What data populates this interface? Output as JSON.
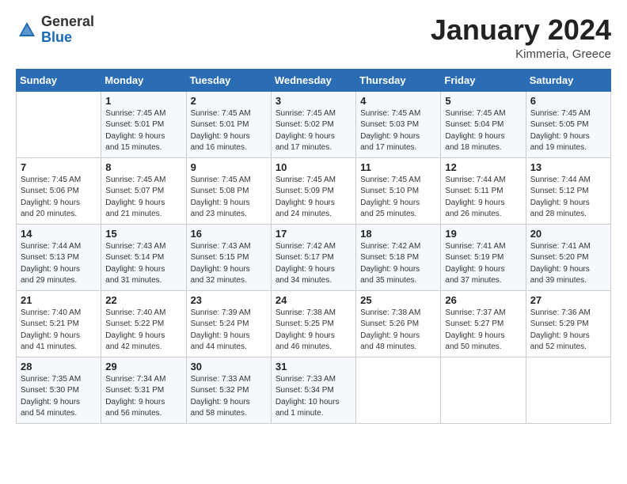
{
  "header": {
    "logo_general": "General",
    "logo_blue": "Blue",
    "month_title": "January 2024",
    "location": "Kimmeria, Greece"
  },
  "weekdays": [
    "Sunday",
    "Monday",
    "Tuesday",
    "Wednesday",
    "Thursday",
    "Friday",
    "Saturday"
  ],
  "weeks": [
    [
      {
        "day": "",
        "info": ""
      },
      {
        "day": "1",
        "info": "Sunrise: 7:45 AM\nSunset: 5:01 PM\nDaylight: 9 hours\nand 15 minutes."
      },
      {
        "day": "2",
        "info": "Sunrise: 7:45 AM\nSunset: 5:01 PM\nDaylight: 9 hours\nand 16 minutes."
      },
      {
        "day": "3",
        "info": "Sunrise: 7:45 AM\nSunset: 5:02 PM\nDaylight: 9 hours\nand 17 minutes."
      },
      {
        "day": "4",
        "info": "Sunrise: 7:45 AM\nSunset: 5:03 PM\nDaylight: 9 hours\nand 17 minutes."
      },
      {
        "day": "5",
        "info": "Sunrise: 7:45 AM\nSunset: 5:04 PM\nDaylight: 9 hours\nand 18 minutes."
      },
      {
        "day": "6",
        "info": "Sunrise: 7:45 AM\nSunset: 5:05 PM\nDaylight: 9 hours\nand 19 minutes."
      }
    ],
    [
      {
        "day": "7",
        "info": "Sunrise: 7:45 AM\nSunset: 5:06 PM\nDaylight: 9 hours\nand 20 minutes."
      },
      {
        "day": "8",
        "info": "Sunrise: 7:45 AM\nSunset: 5:07 PM\nDaylight: 9 hours\nand 21 minutes."
      },
      {
        "day": "9",
        "info": "Sunrise: 7:45 AM\nSunset: 5:08 PM\nDaylight: 9 hours\nand 23 minutes."
      },
      {
        "day": "10",
        "info": "Sunrise: 7:45 AM\nSunset: 5:09 PM\nDaylight: 9 hours\nand 24 minutes."
      },
      {
        "day": "11",
        "info": "Sunrise: 7:45 AM\nSunset: 5:10 PM\nDaylight: 9 hours\nand 25 minutes."
      },
      {
        "day": "12",
        "info": "Sunrise: 7:44 AM\nSunset: 5:11 PM\nDaylight: 9 hours\nand 26 minutes."
      },
      {
        "day": "13",
        "info": "Sunrise: 7:44 AM\nSunset: 5:12 PM\nDaylight: 9 hours\nand 28 minutes."
      }
    ],
    [
      {
        "day": "14",
        "info": "Sunrise: 7:44 AM\nSunset: 5:13 PM\nDaylight: 9 hours\nand 29 minutes."
      },
      {
        "day": "15",
        "info": "Sunrise: 7:43 AM\nSunset: 5:14 PM\nDaylight: 9 hours\nand 31 minutes."
      },
      {
        "day": "16",
        "info": "Sunrise: 7:43 AM\nSunset: 5:15 PM\nDaylight: 9 hours\nand 32 minutes."
      },
      {
        "day": "17",
        "info": "Sunrise: 7:42 AM\nSunset: 5:17 PM\nDaylight: 9 hours\nand 34 minutes."
      },
      {
        "day": "18",
        "info": "Sunrise: 7:42 AM\nSunset: 5:18 PM\nDaylight: 9 hours\nand 35 minutes."
      },
      {
        "day": "19",
        "info": "Sunrise: 7:41 AM\nSunset: 5:19 PM\nDaylight: 9 hours\nand 37 minutes."
      },
      {
        "day": "20",
        "info": "Sunrise: 7:41 AM\nSunset: 5:20 PM\nDaylight: 9 hours\nand 39 minutes."
      }
    ],
    [
      {
        "day": "21",
        "info": "Sunrise: 7:40 AM\nSunset: 5:21 PM\nDaylight: 9 hours\nand 41 minutes."
      },
      {
        "day": "22",
        "info": "Sunrise: 7:40 AM\nSunset: 5:22 PM\nDaylight: 9 hours\nand 42 minutes."
      },
      {
        "day": "23",
        "info": "Sunrise: 7:39 AM\nSunset: 5:24 PM\nDaylight: 9 hours\nand 44 minutes."
      },
      {
        "day": "24",
        "info": "Sunrise: 7:38 AM\nSunset: 5:25 PM\nDaylight: 9 hours\nand 46 minutes."
      },
      {
        "day": "25",
        "info": "Sunrise: 7:38 AM\nSunset: 5:26 PM\nDaylight: 9 hours\nand 48 minutes."
      },
      {
        "day": "26",
        "info": "Sunrise: 7:37 AM\nSunset: 5:27 PM\nDaylight: 9 hours\nand 50 minutes."
      },
      {
        "day": "27",
        "info": "Sunrise: 7:36 AM\nSunset: 5:29 PM\nDaylight: 9 hours\nand 52 minutes."
      }
    ],
    [
      {
        "day": "28",
        "info": "Sunrise: 7:35 AM\nSunset: 5:30 PM\nDaylight: 9 hours\nand 54 minutes."
      },
      {
        "day": "29",
        "info": "Sunrise: 7:34 AM\nSunset: 5:31 PM\nDaylight: 9 hours\nand 56 minutes."
      },
      {
        "day": "30",
        "info": "Sunrise: 7:33 AM\nSunset: 5:32 PM\nDaylight: 9 hours\nand 58 minutes."
      },
      {
        "day": "31",
        "info": "Sunrise: 7:33 AM\nSunset: 5:34 PM\nDaylight: 10 hours\nand 1 minute."
      },
      {
        "day": "",
        "info": ""
      },
      {
        "day": "",
        "info": ""
      },
      {
        "day": "",
        "info": ""
      }
    ]
  ]
}
